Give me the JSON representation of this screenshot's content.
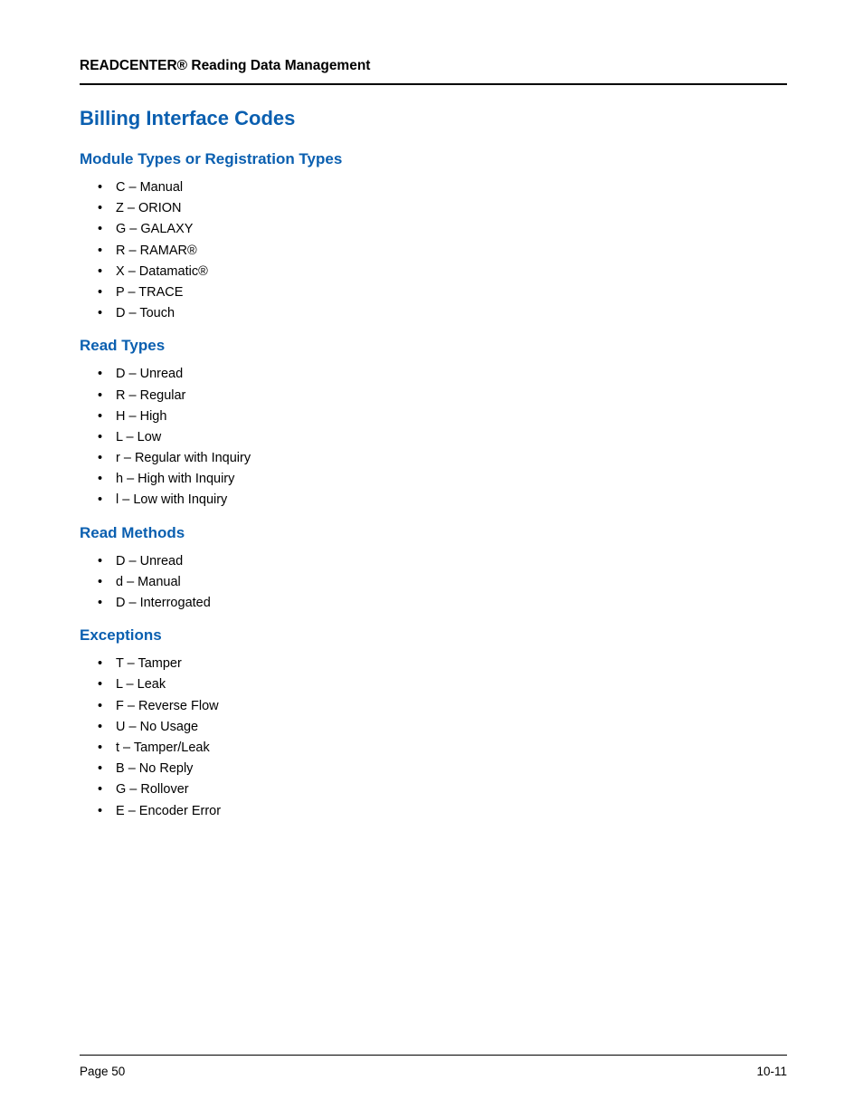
{
  "header": "READCENTER® Reading Data Management",
  "title": "Billing Interface Codes",
  "sections": {
    "s0": {
      "heading": "Module Types or Registration Types",
      "i0": "C – Manual",
      "i1": "Z – ORION",
      "i2": "G – GALAXY",
      "i3": "R – RAMAR®",
      "i4": "X – Datamatic®",
      "i5": "P – TRACE",
      "i6": "D – Touch"
    },
    "s1": {
      "heading": "Read Types",
      "i0": "D – Unread",
      "i1": "R – Regular",
      "i2": "H – High",
      "i3": "L – Low",
      "i4": "r – Regular with Inquiry",
      "i5": "h – High with Inquiry",
      "i6": "l – Low with Inquiry"
    },
    "s2": {
      "heading": "Read Methods",
      "i0": "D – Unread",
      "i1": "d – Manual",
      "i2": "D – Interrogated"
    },
    "s3": {
      "heading": "Exceptions",
      "i0": "T – Tamper",
      "i1": "L – Leak",
      "i2": "F – Reverse Flow",
      "i3": "U – No Usage",
      "i4": "t – Tamper/Leak",
      "i5": "B – No Reply",
      "i6": "G – Rollover",
      "i7": "E – Encoder Error"
    }
  },
  "footer": {
    "left": "Page 50",
    "right": "10-11"
  }
}
